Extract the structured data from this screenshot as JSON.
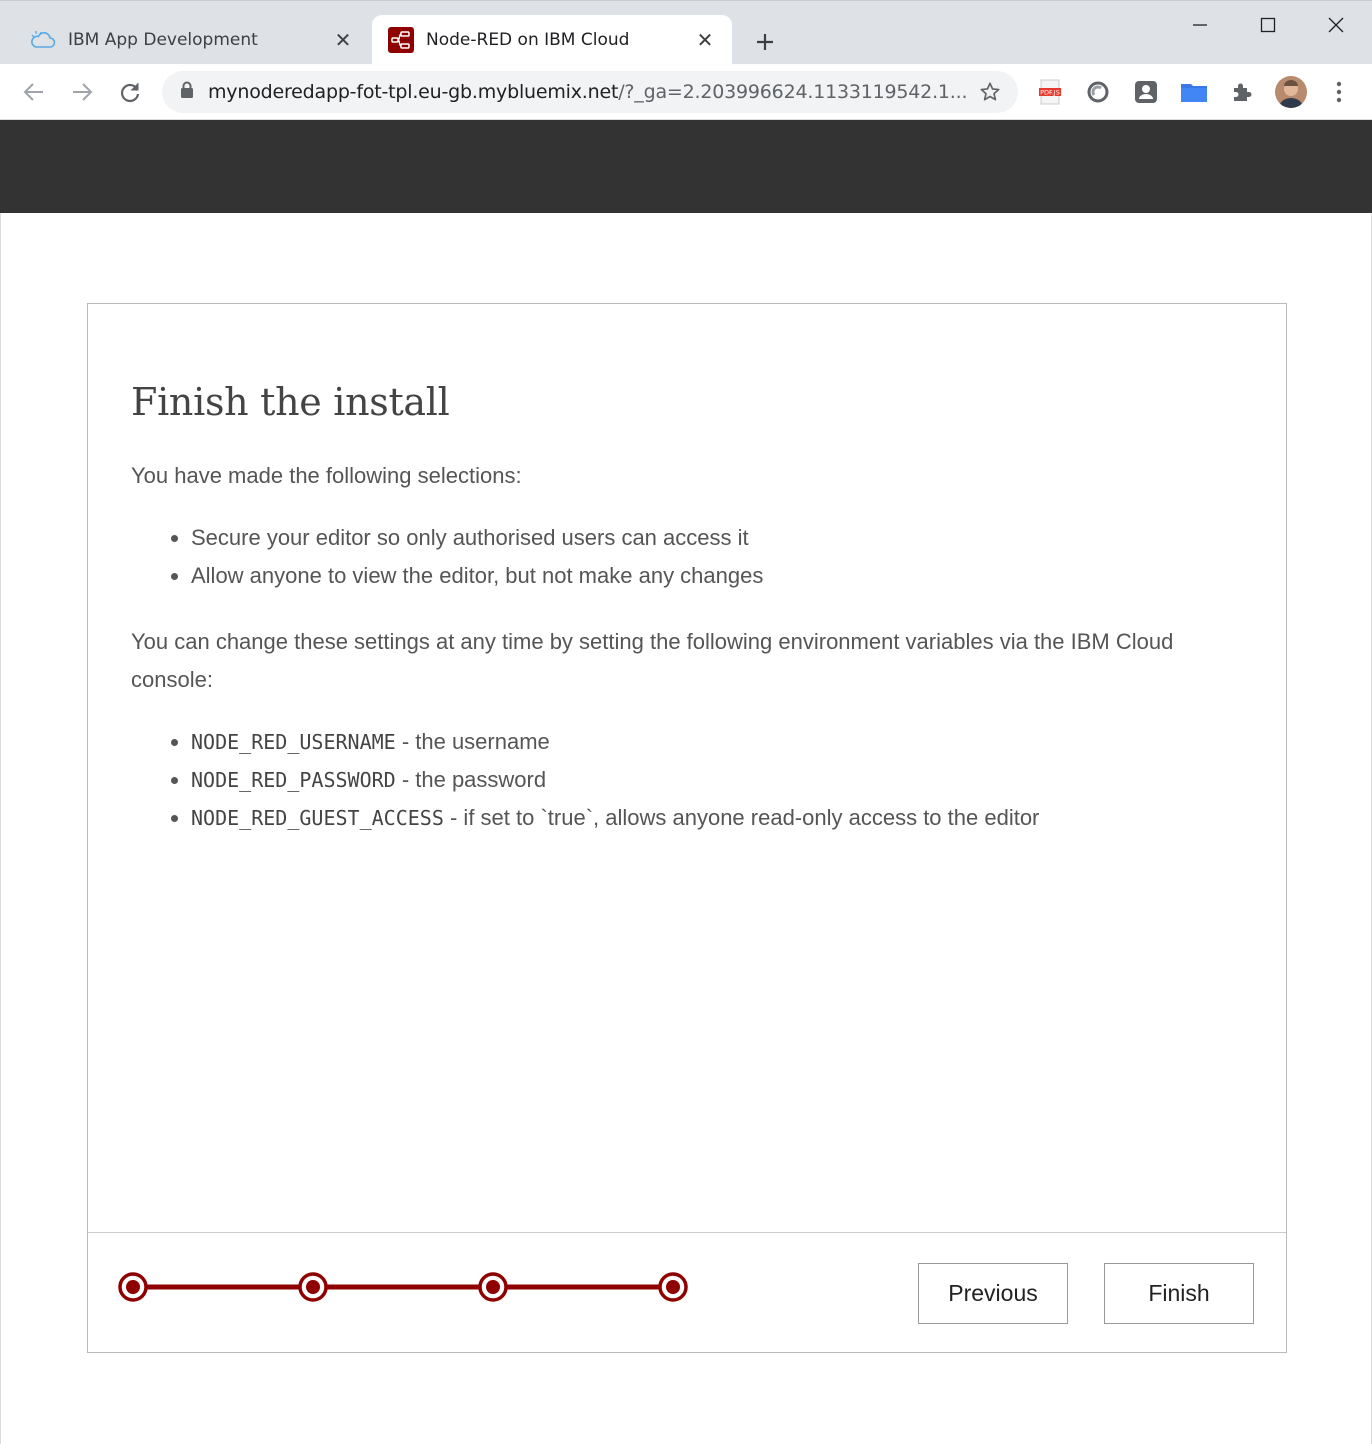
{
  "browser": {
    "tabs": [
      {
        "title": "IBM App Development",
        "icon": "cloud-icon",
        "active": false
      },
      {
        "title": "Node-RED on IBM Cloud",
        "icon": "node-red-icon",
        "active": true
      }
    ],
    "url_host": "mynoderedapp-fot-tpl.eu-gb.mybluemix.net",
    "url_rest": "/?_ga=2.203996624.1133119542.1...",
    "extensions": [
      "pdf-icon",
      "circle-extension-icon",
      "profile-card-icon",
      "folder-icon",
      "puzzle-icon"
    ],
    "colors": {
      "tabbar": "#dee1e6",
      "omnibox": "#f1f3f4"
    }
  },
  "page": {
    "header_color": "#333333",
    "title": "Finish the install",
    "intro": "You have made the following selections:",
    "selections": [
      "Secure your editor so only authorised users can access it",
      "Allow anyone to view the editor, but not make any changes"
    ],
    "change_note": "You can change these settings at any time by setting the following environment variables via the IBM Cloud console:",
    "env_vars": [
      {
        "name": "NODE_RED_USERNAME",
        "desc": " - the username"
      },
      {
        "name": "NODE_RED_PASSWORD",
        "desc": " - the password"
      },
      {
        "name": "NODE_RED_GUEST_ACCESS",
        "desc": " - if set to `true`, allows anyone read-only access to the editor"
      }
    ],
    "progress": {
      "steps_total": 4,
      "current_step": 4,
      "color": "#8f0000"
    },
    "buttons": {
      "previous": "Previous",
      "finish": "Finish"
    }
  }
}
